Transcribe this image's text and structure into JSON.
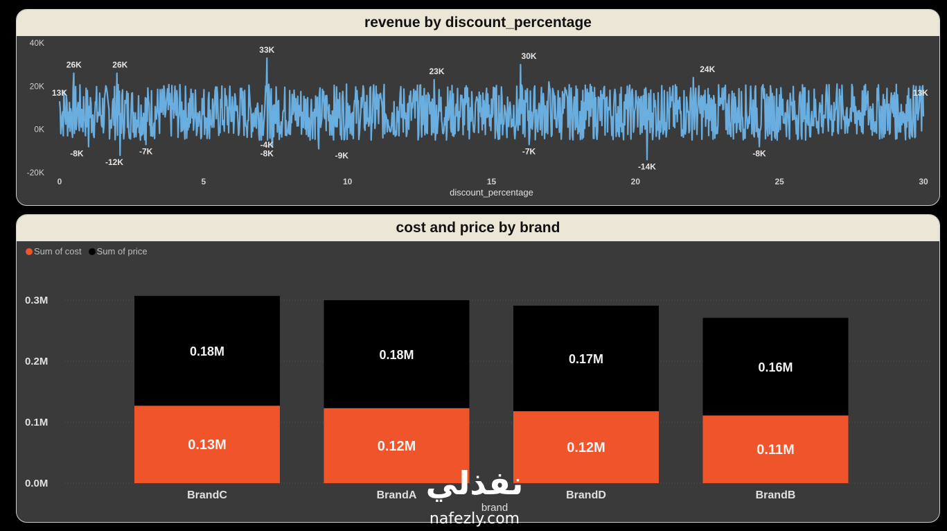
{
  "colors": {
    "line": "#6aaee0",
    "cost": "#f0542a",
    "price": "#000000",
    "panel_bg": "#3a3a3a",
    "header_bg": "#ece6d6",
    "label": "#e6e6e6",
    "axis_text": "#cfcfcf"
  },
  "chart_data": [
    {
      "type": "line",
      "title": "revenue by discount_percentage",
      "xlabel": "discount_percentage",
      "ylabel": "",
      "xlim": [
        0,
        30
      ],
      "ylim": [
        -20000,
        40000
      ],
      "x_ticks": [
        "0",
        "5",
        "10",
        "15",
        "20",
        "25",
        "30"
      ],
      "y_ticks": [
        "40K",
        "20K",
        "0K",
        "-20K"
      ],
      "series": [
        {
          "name": "",
          "x": [
            0,
            0.5,
            1,
            2,
            2.1,
            3,
            4,
            5,
            6,
            7.2,
            7.3,
            7.4,
            8,
            9,
            10,
            11,
            12,
            13,
            14,
            15,
            16,
            16.3,
            16.4,
            17,
            18,
            19,
            20,
            20.4,
            21,
            22,
            22.5,
            23,
            24,
            24.3,
            25,
            26,
            27,
            28,
            29,
            29.9,
            30
          ],
          "y": [
            13000,
            26000,
            -8000,
            26000,
            -12000,
            -7000,
            20000,
            10000,
            15000,
            33000,
            -4000,
            -8000,
            18000,
            -9000,
            12000,
            20000,
            5000,
            23000,
            10000,
            14000,
            30000,
            -7000,
            8000,
            22000,
            -2000,
            15000,
            10000,
            -14000,
            18000,
            24000,
            5000,
            12000,
            20000,
            -8000,
            16000,
            2000,
            21000,
            9000,
            17000,
            13000,
            6000
          ]
        }
      ],
      "data_labels": [
        {
          "text": "13K",
          "x": 0,
          "y": 13000
        },
        {
          "text": "26K",
          "x": 0.5,
          "y": 26000
        },
        {
          "text": "-8K",
          "x": 0.6,
          "y": -8000
        },
        {
          "text": "26K",
          "x": 2.1,
          "y": 26000
        },
        {
          "text": "-12K",
          "x": 1.9,
          "y": -12000
        },
        {
          "text": "-7K",
          "x": 3,
          "y": -7000
        },
        {
          "text": "33K",
          "x": 7.2,
          "y": 33000
        },
        {
          "text": "-4K",
          "x": 7.2,
          "y": -4000
        },
        {
          "text": "-8K",
          "x": 7.2,
          "y": -8000
        },
        {
          "text": "-9K",
          "x": 9.8,
          "y": -9000
        },
        {
          "text": "23K",
          "x": 13.1,
          "y": 23000
        },
        {
          "text": "30K",
          "x": 16.3,
          "y": 30000
        },
        {
          "text": "-7K",
          "x": 16.3,
          "y": -7000
        },
        {
          "text": "-14K",
          "x": 20.4,
          "y": -14000
        },
        {
          "text": "24K",
          "x": 22.5,
          "y": 24000
        },
        {
          "text": "-8K",
          "x": 24.3,
          "y": -8000
        },
        {
          "text": "13K",
          "x": 29.9,
          "y": 13000
        }
      ]
    },
    {
      "type": "bar",
      "stacked": true,
      "title": "cost and price by brand",
      "xlabel": "brand",
      "ylabel": "",
      "categories": [
        "BrandC",
        "BrandA",
        "BrandD",
        "BrandB"
      ],
      "ylim": [
        0,
        0.3
      ],
      "y_ticks": [
        "0.3M",
        "0.2M",
        "0.1M",
        "0.0M"
      ],
      "legend_position": "top-left",
      "series": [
        {
          "name": "Sum of cost",
          "values": [
            0.127,
            0.123,
            0.118,
            0.111
          ],
          "labels": [
            "0.13M",
            "0.12M",
            "0.12M",
            "0.11M"
          ]
        },
        {
          "name": "Sum of price",
          "values": [
            0.18,
            0.177,
            0.173,
            0.16
          ],
          "labels": [
            "0.18M",
            "0.18M",
            "0.17M",
            "0.16M"
          ]
        }
      ]
    }
  ],
  "watermark": {
    "arabic": "نفذلي",
    "latin": "nafezly.com"
  }
}
